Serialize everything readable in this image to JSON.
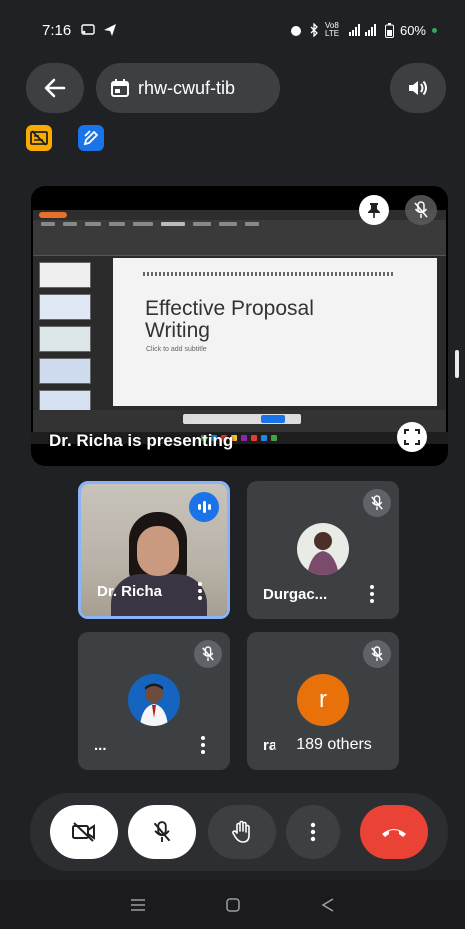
{
  "status_bar": {
    "time": "7:16",
    "network": "Vo8 LTE",
    "battery": "60%"
  },
  "top_bar": {
    "meeting_code": "rhw-cwuf-tib"
  },
  "presentation": {
    "presenter_label": "Dr. Richa is presenting",
    "slide_title": "Effective Proposal Writing",
    "slide_subtitle": "Click to add subtitle"
  },
  "participants": [
    {
      "name": "Dr. Richa",
      "speaking": true,
      "muted": false
    },
    {
      "name": "Durgac...",
      "speaking": false,
      "muted": true
    },
    {
      "name": "...",
      "speaking": false,
      "muted": true
    },
    {
      "name": "ra",
      "avatar_letter": "r",
      "avatar_color": "#e8710a",
      "speaking": false,
      "muted": true
    }
  ],
  "others_label": "189 others",
  "controls": [
    "camera-off",
    "mic-off",
    "raise-hand",
    "more-options",
    "leave-call"
  ],
  "colors": {
    "background": "#202124",
    "tile": "#3c4043",
    "accent": "#8ab4f8",
    "leave": "#ea4335",
    "speaking": "#1a73e8"
  }
}
